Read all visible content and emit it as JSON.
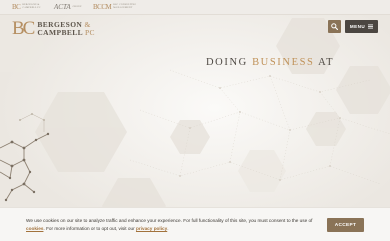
{
  "topbar": {
    "brands": [
      {
        "mark": "BC",
        "lines": [
          "BERGESON &",
          "CAMPBELL PC"
        ]
      },
      {
        "mark": "ACTA",
        "lines": [
          "ACTA",
          "GROUP"
        ]
      },
      {
        "mark": "BCCM",
        "lines": [
          "BSC CONSULTING",
          "MANAGEMENT"
        ]
      }
    ]
  },
  "header": {
    "logo_mark": "BC",
    "logo_line1": "BERGESON",
    "logo_amp": "&",
    "logo_line2": "CAMPBELL",
    "logo_pc": "PC",
    "menu_label": "MENU"
  },
  "hero": {
    "headline_pre": "DOING",
    "headline_accent": "BUSINESS",
    "headline_post": "AT"
  },
  "cookie_banner": {
    "text_part1": "We use cookies on our site to analyze traffic and enhance your experience. For full functionality of this site, you must consent to the use of",
    "link_cookies": "cookies",
    "text_part2": ". For more information or to opt out, visit our",
    "link_privacy": "privacy policy",
    "text_part3": ".",
    "accept_label": "ACCEPT"
  },
  "colors": {
    "accent_gold": "#b58e60",
    "button_brown": "#8a7357",
    "menu_dark": "#4b4641"
  }
}
